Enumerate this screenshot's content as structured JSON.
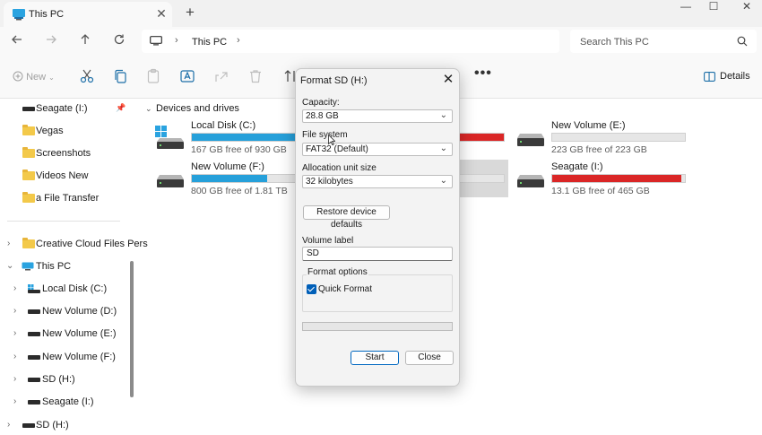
{
  "window": {
    "tab_title": "This PC",
    "new_tab": "+",
    "minimize": "—",
    "maximize": "☐",
    "close": "✕"
  },
  "navbar": {
    "breadcrumb": "This PC",
    "search_placeholder": "Search This PC"
  },
  "commandbar": {
    "new_label": "New",
    "more": "•••",
    "details_label": "Details"
  },
  "sidebar": {
    "items": [
      {
        "label": "Seagate (I:)",
        "icon": "drive-icon",
        "pinned": true
      },
      {
        "label": "Vegas",
        "icon": "folder-icon"
      },
      {
        "label": "Screenshots",
        "icon": "folder-icon"
      },
      {
        "label": "Videos New",
        "icon": "folder-icon"
      },
      {
        "label": "a File Transfer",
        "icon": "folder-icon"
      },
      {
        "label": "Creative Cloud Files Pers",
        "icon": "folder-icon"
      },
      {
        "label": "This PC",
        "icon": "pc-icon",
        "expanded": true
      },
      {
        "label": "Local Disk (C:)",
        "icon": "windows-drive-icon"
      },
      {
        "label": "New Volume (D:)",
        "icon": "drive-icon"
      },
      {
        "label": "New Volume (E:)",
        "icon": "drive-icon"
      },
      {
        "label": "New Volume (F:)",
        "icon": "drive-icon"
      },
      {
        "label": "SD (H:)",
        "icon": "drive-icon"
      },
      {
        "label": "Seagate (I:)",
        "icon": "drive-icon"
      },
      {
        "label": "SD (H:)",
        "icon": "drive-icon"
      }
    ]
  },
  "content": {
    "section_title": "Devices and drives",
    "drives": [
      {
        "name": "Local Disk (C:)",
        "free": "167 GB free of 930 GB",
        "used_fraction": 0.82,
        "bar_color": "#26a0da"
      },
      {
        "name": "New Volume (E:)",
        "free": "223 GB free of 223 GB",
        "used_fraction": 0.0,
        "bar_color": "#26a0da"
      },
      {
        "name": "New Volume (F:)",
        "free": "800 GB free of 1.81 TB",
        "used_fraction": 0.57,
        "bar_color": "#26a0da"
      },
      {
        "name": "Seagate (I:)",
        "free": "13.1 GB free of 465 GB",
        "used_fraction": 0.97,
        "bar_color": "#da2626"
      }
    ]
  },
  "dialog": {
    "title": "Format SD (H:)",
    "capacity_label": "Capacity:",
    "capacity_value": "28.8 GB",
    "filesystem_label": "File system",
    "filesystem_value": "FAT32 (Default)",
    "allocation_label": "Allocation unit size",
    "allocation_value": "32 kilobytes",
    "restore_button": "Restore device defaults",
    "volume_label": "Volume label",
    "volume_value": "SD",
    "format_options": "Format options",
    "quick_format": "Quick Format",
    "quick_format_checked": true,
    "progress": 0,
    "start_button": "Start",
    "close_button": "Close",
    "close_icon": "✕"
  },
  "colors": {
    "accent": "#005fb8",
    "drive_bar_blue": "#26a0da",
    "drive_bar_red": "#da2626"
  }
}
